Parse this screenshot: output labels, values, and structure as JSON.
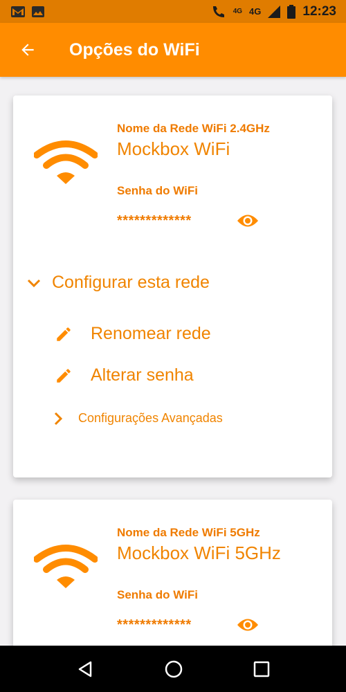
{
  "status_bar": {
    "left_icons": [
      "gmail-icon",
      "image-icon"
    ],
    "network_4g_small": "4G",
    "network_4g": "4G",
    "time": "12:23"
  },
  "app_bar": {
    "title": "Opções do WiFi",
    "back_icon": "arrow-back-icon"
  },
  "networks": [
    {
      "name_label": "Nome da Rede WiFi 2.4GHz",
      "name": "Mockbox WiFi",
      "password_label": "Senha do WiFi",
      "password": "*************",
      "config_label": "Configurar esta rede",
      "actions": [
        {
          "label": "Renomear rede",
          "icon": "pencil-icon"
        },
        {
          "label": "Alterar senha",
          "icon": "pencil-icon"
        }
      ],
      "advanced_label": "Configurações Avançadas"
    },
    {
      "name_label": "Nome da Rede WiFi 5GHz",
      "name": "Mockbox WiFi 5GHz",
      "password_label": "Senha do WiFi",
      "password": "*************"
    }
  ],
  "colors": {
    "primary": "#ff8c00",
    "status_bar": "#e07c00",
    "accent_text": "#f08400",
    "background": "#f2f1f3"
  }
}
